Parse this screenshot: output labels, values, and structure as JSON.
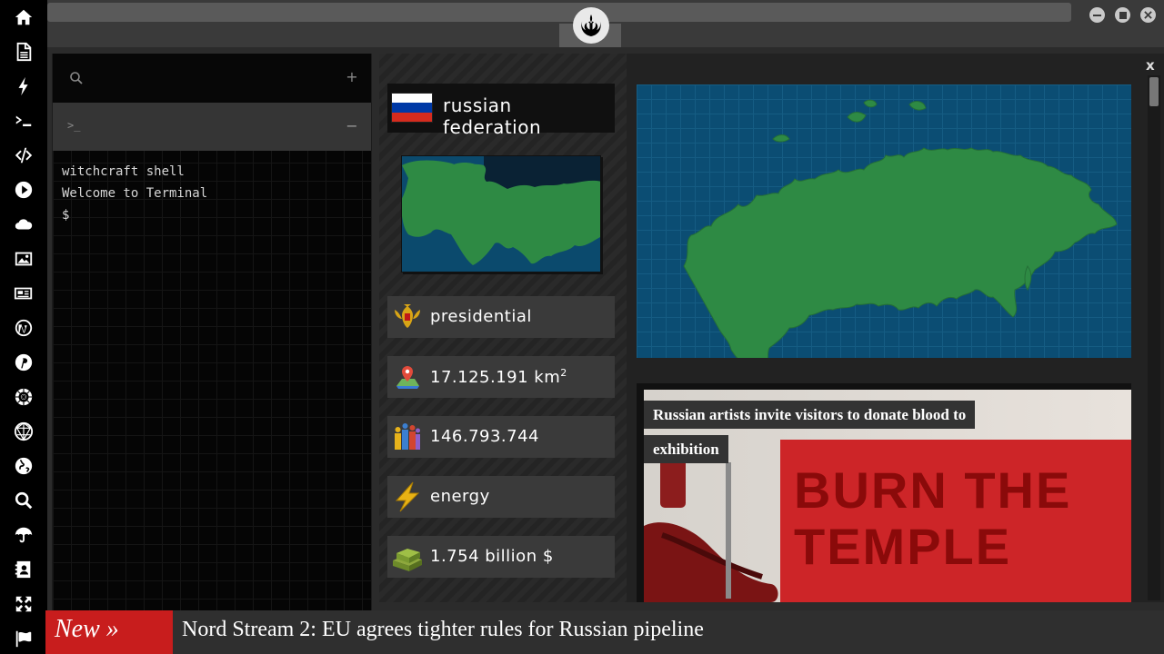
{
  "sidebar": {
    "items": [
      {
        "icon": "home-icon"
      },
      {
        "icon": "document-icon"
      },
      {
        "icon": "lightning-icon"
      },
      {
        "icon": "terminal-icon"
      },
      {
        "icon": "code-icon"
      },
      {
        "icon": "play-icon"
      },
      {
        "icon": "cloud-icon"
      },
      {
        "icon": "image-icon"
      },
      {
        "icon": "newspaper-icon"
      },
      {
        "icon": "wordpress-icon"
      },
      {
        "icon": "pinterest-icon"
      },
      {
        "icon": "rebel-alliance-icon"
      },
      {
        "icon": "geodesic-icon"
      },
      {
        "icon": "globe-icon"
      },
      {
        "icon": "search-icon"
      },
      {
        "icon": "umbrella-icon"
      },
      {
        "icon": "contacts-icon"
      },
      {
        "icon": "expand-icon"
      },
      {
        "icon": "flag-icon"
      }
    ]
  },
  "terminal": {
    "plus_label": "+",
    "prompt_symbol": ">_",
    "minus_label": "−",
    "lines": [
      "witchcraft shell",
      "Welcome to Terminal",
      "$"
    ]
  },
  "country": {
    "name": "russian federation",
    "flag_colors": [
      "#ffffff",
      "#0039a6",
      "#d52b1e"
    ],
    "stats": {
      "government": "presidential",
      "area_value": "17.125.191 km",
      "area_unit_sup": "2",
      "population": "146.793.744",
      "economy_sector": "energy",
      "gdp": "1.754 billion $"
    }
  },
  "news": {
    "headline_line1": "Russian artists invite visitors to donate blood to",
    "headline_line2": "exhibition",
    "image_text_line1": "BURN THE",
    "image_text_line2": "TEMPLE"
  },
  "info_panel": {
    "close_label": "x"
  },
  "ticker": {
    "badge": "New »",
    "text": "Nord Stream 2: EU agrees tighter rules for Russian pipeline"
  },
  "colors": {
    "ticker_badge": "#c81d1d",
    "ocean": "#0b4d73",
    "land": "#2e8a44"
  }
}
